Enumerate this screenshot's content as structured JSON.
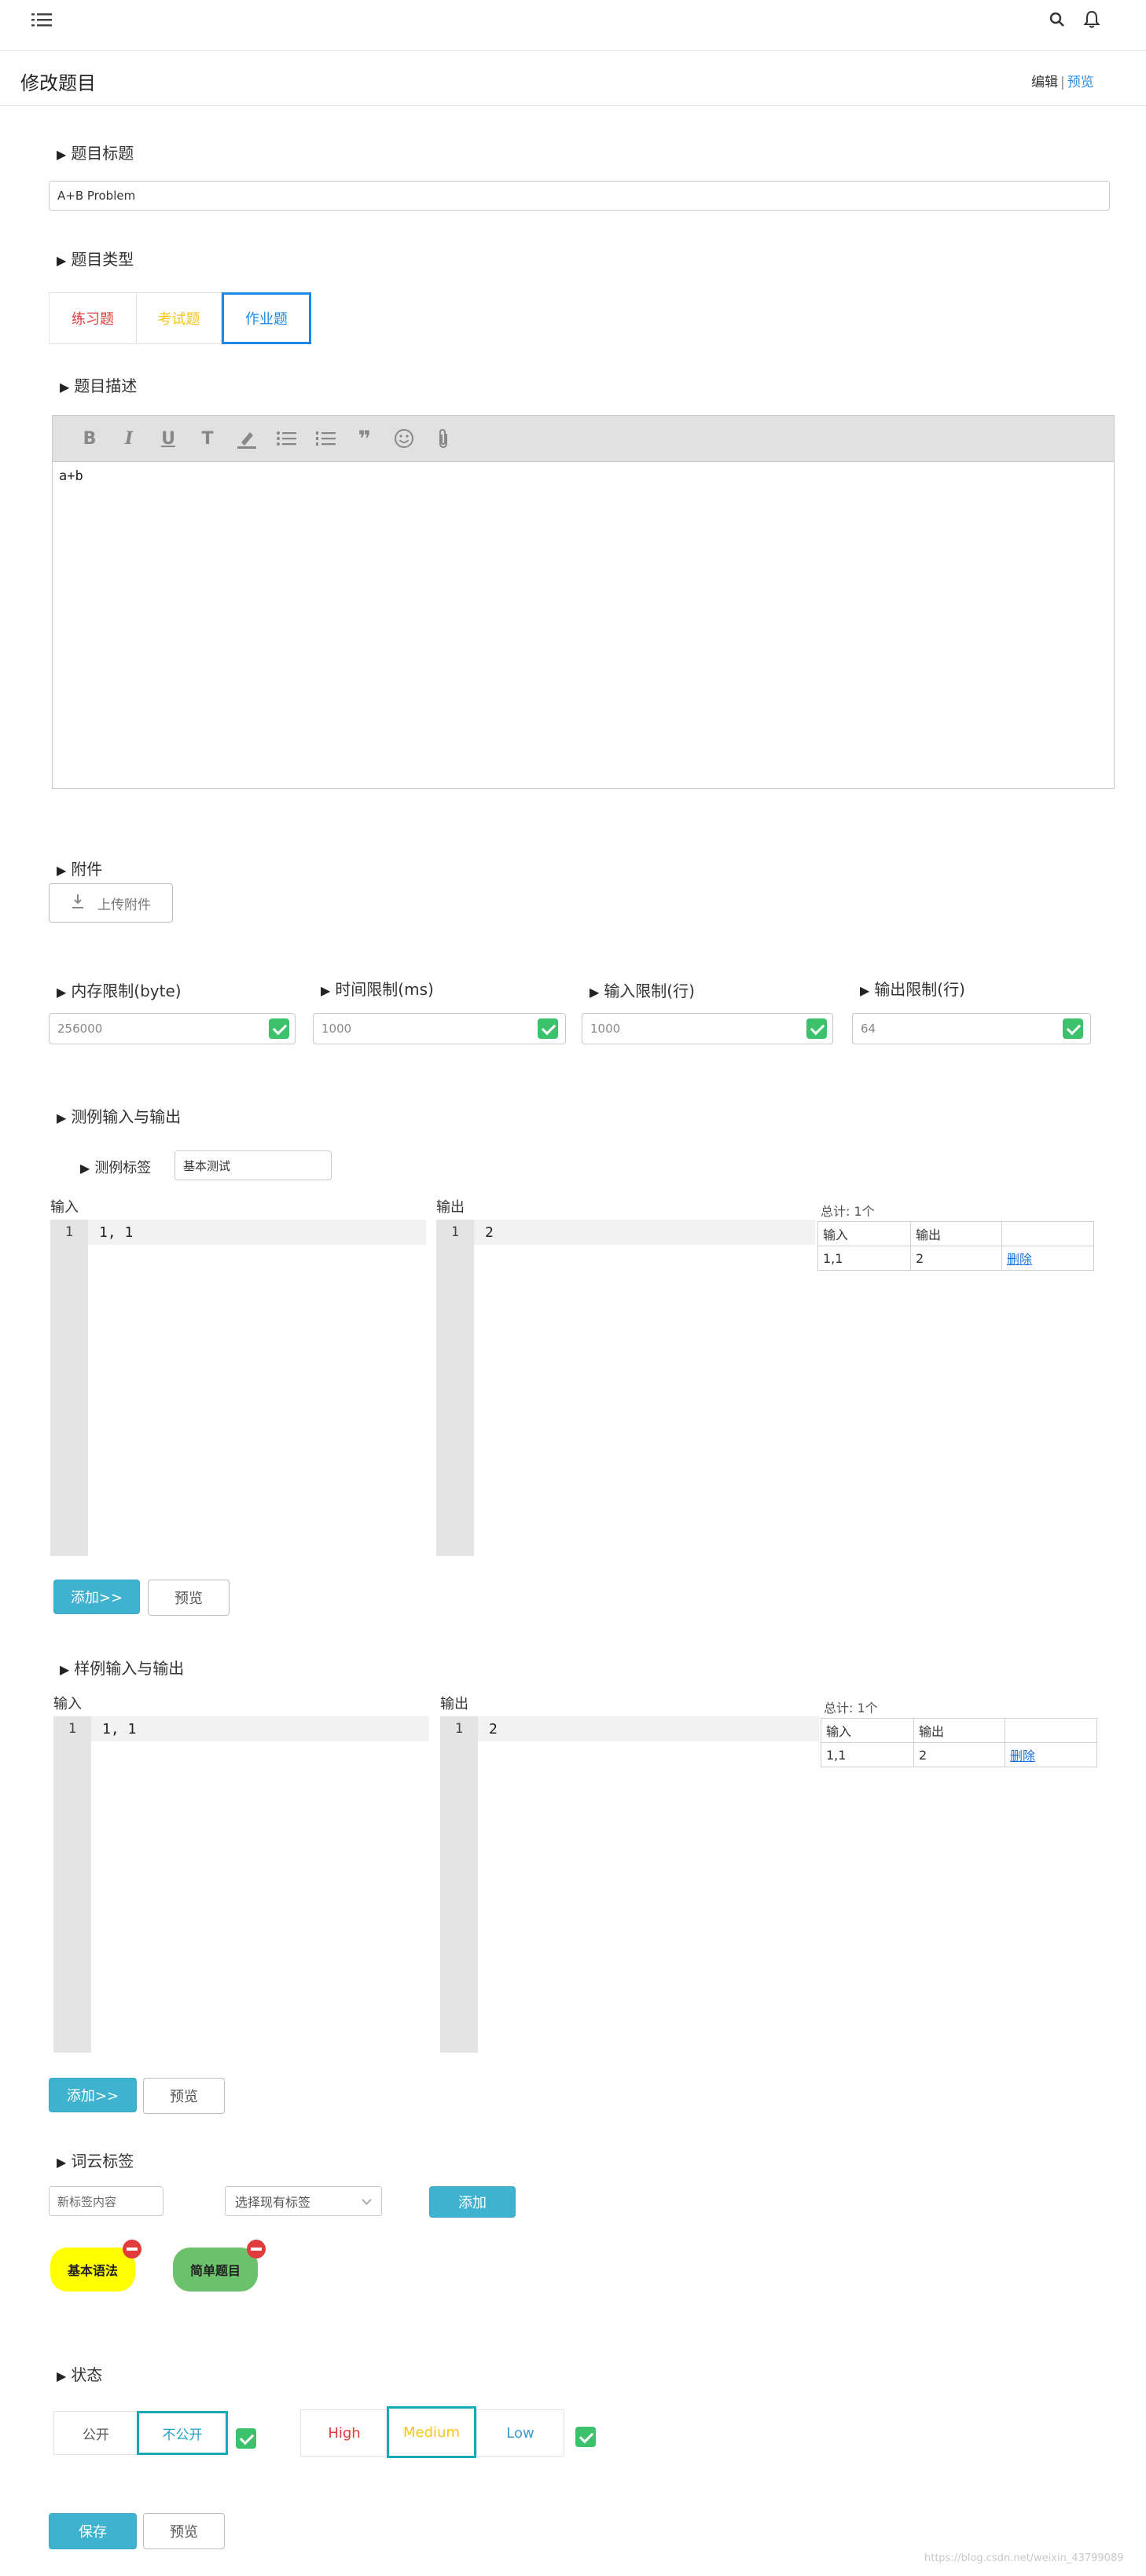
{
  "header": {
    "menu_icon": "menu-icon",
    "search_icon": "search-icon",
    "bell_icon": "bell-icon"
  },
  "page": {
    "title": "修改题目",
    "mode_edit": "编辑",
    "mode_sep": "|",
    "mode_preview": "预览"
  },
  "title_section": {
    "label": "题目标题",
    "value": "A+B Problem"
  },
  "type_section": {
    "label": "题目类型",
    "options": [
      "练习题",
      "考试题",
      "作业题"
    ],
    "selected": "作业题"
  },
  "desc_section": {
    "label": "题目描述",
    "toolbar": [
      "bold-icon",
      "italic-icon",
      "underline-icon",
      "text-icon",
      "highlighter-icon",
      "bullet-list-icon",
      "numbered-list-icon",
      "quote-icon",
      "emoji-icon",
      "attachment-icon"
    ],
    "content": "a+b"
  },
  "attach_section": {
    "label": "附件",
    "upload_label": "上传附件"
  },
  "limits": [
    {
      "label": "内存限制(byte)",
      "value": "256000"
    },
    {
      "label": "时间限制(ms)",
      "value": "1000"
    },
    {
      "label": "输入限制(行)",
      "value": "1000"
    },
    {
      "label": "输出限制(行)",
      "value": "64"
    }
  ],
  "test_section": {
    "label": "测例输入与输出",
    "tag_label": "测例标签",
    "tag_value": "基本测试",
    "input_label": "输入",
    "output_label": "输出",
    "input_line_no": "1",
    "input_code": "1, 1",
    "output_line_no": "1",
    "output_code": "2",
    "total": "总计: 1个",
    "table_headers": [
      "输入",
      "输出",
      ""
    ],
    "rows": [
      {
        "input": "1,1",
        "output": "2",
        "action": "删除"
      }
    ],
    "add_button": "添加>>",
    "preview_button": "预览"
  },
  "sample_section": {
    "label": "样例输入与输出",
    "input_label": "输入",
    "output_label": "输出",
    "input_line_no": "1",
    "input_code": "1, 1",
    "output_line_no": "1",
    "output_code": "2",
    "total": "总计: 1个",
    "table_headers": [
      "输入",
      "输出",
      ""
    ],
    "rows": [
      {
        "input": "1,1",
        "output": "2",
        "action": "删除"
      }
    ],
    "add_button": "添加>>",
    "preview_button": "预览"
  },
  "tags_section": {
    "label": "词云标签",
    "new_tag_placeholder": "新标签内容",
    "select_placeholder": "选择现有标签",
    "add_button": "添加",
    "tags": [
      {
        "text": "基本语法",
        "color": "#ffff00"
      },
      {
        "text": "简单题目",
        "color": "#6cc26c"
      }
    ]
  },
  "status_section": {
    "label": "状态",
    "visibility": [
      "公开",
      "不公开"
    ],
    "visibility_selected": "不公开",
    "difficulty": [
      "High",
      "Medium",
      "Low"
    ],
    "difficulty_selected": "Medium",
    "difficulty_colors": {
      "High": "#e23b3b",
      "Medium": "#f5c518",
      "Low": "#3a9bd9"
    }
  },
  "footer": {
    "save_button": "保存",
    "preview_button": "预览",
    "watermark": "https://blog.csdn.net/weixin_43799089"
  },
  "colors": {
    "primary": "#3eb2cf",
    "link": "#1a6fd6",
    "check": "#3cc26d"
  }
}
